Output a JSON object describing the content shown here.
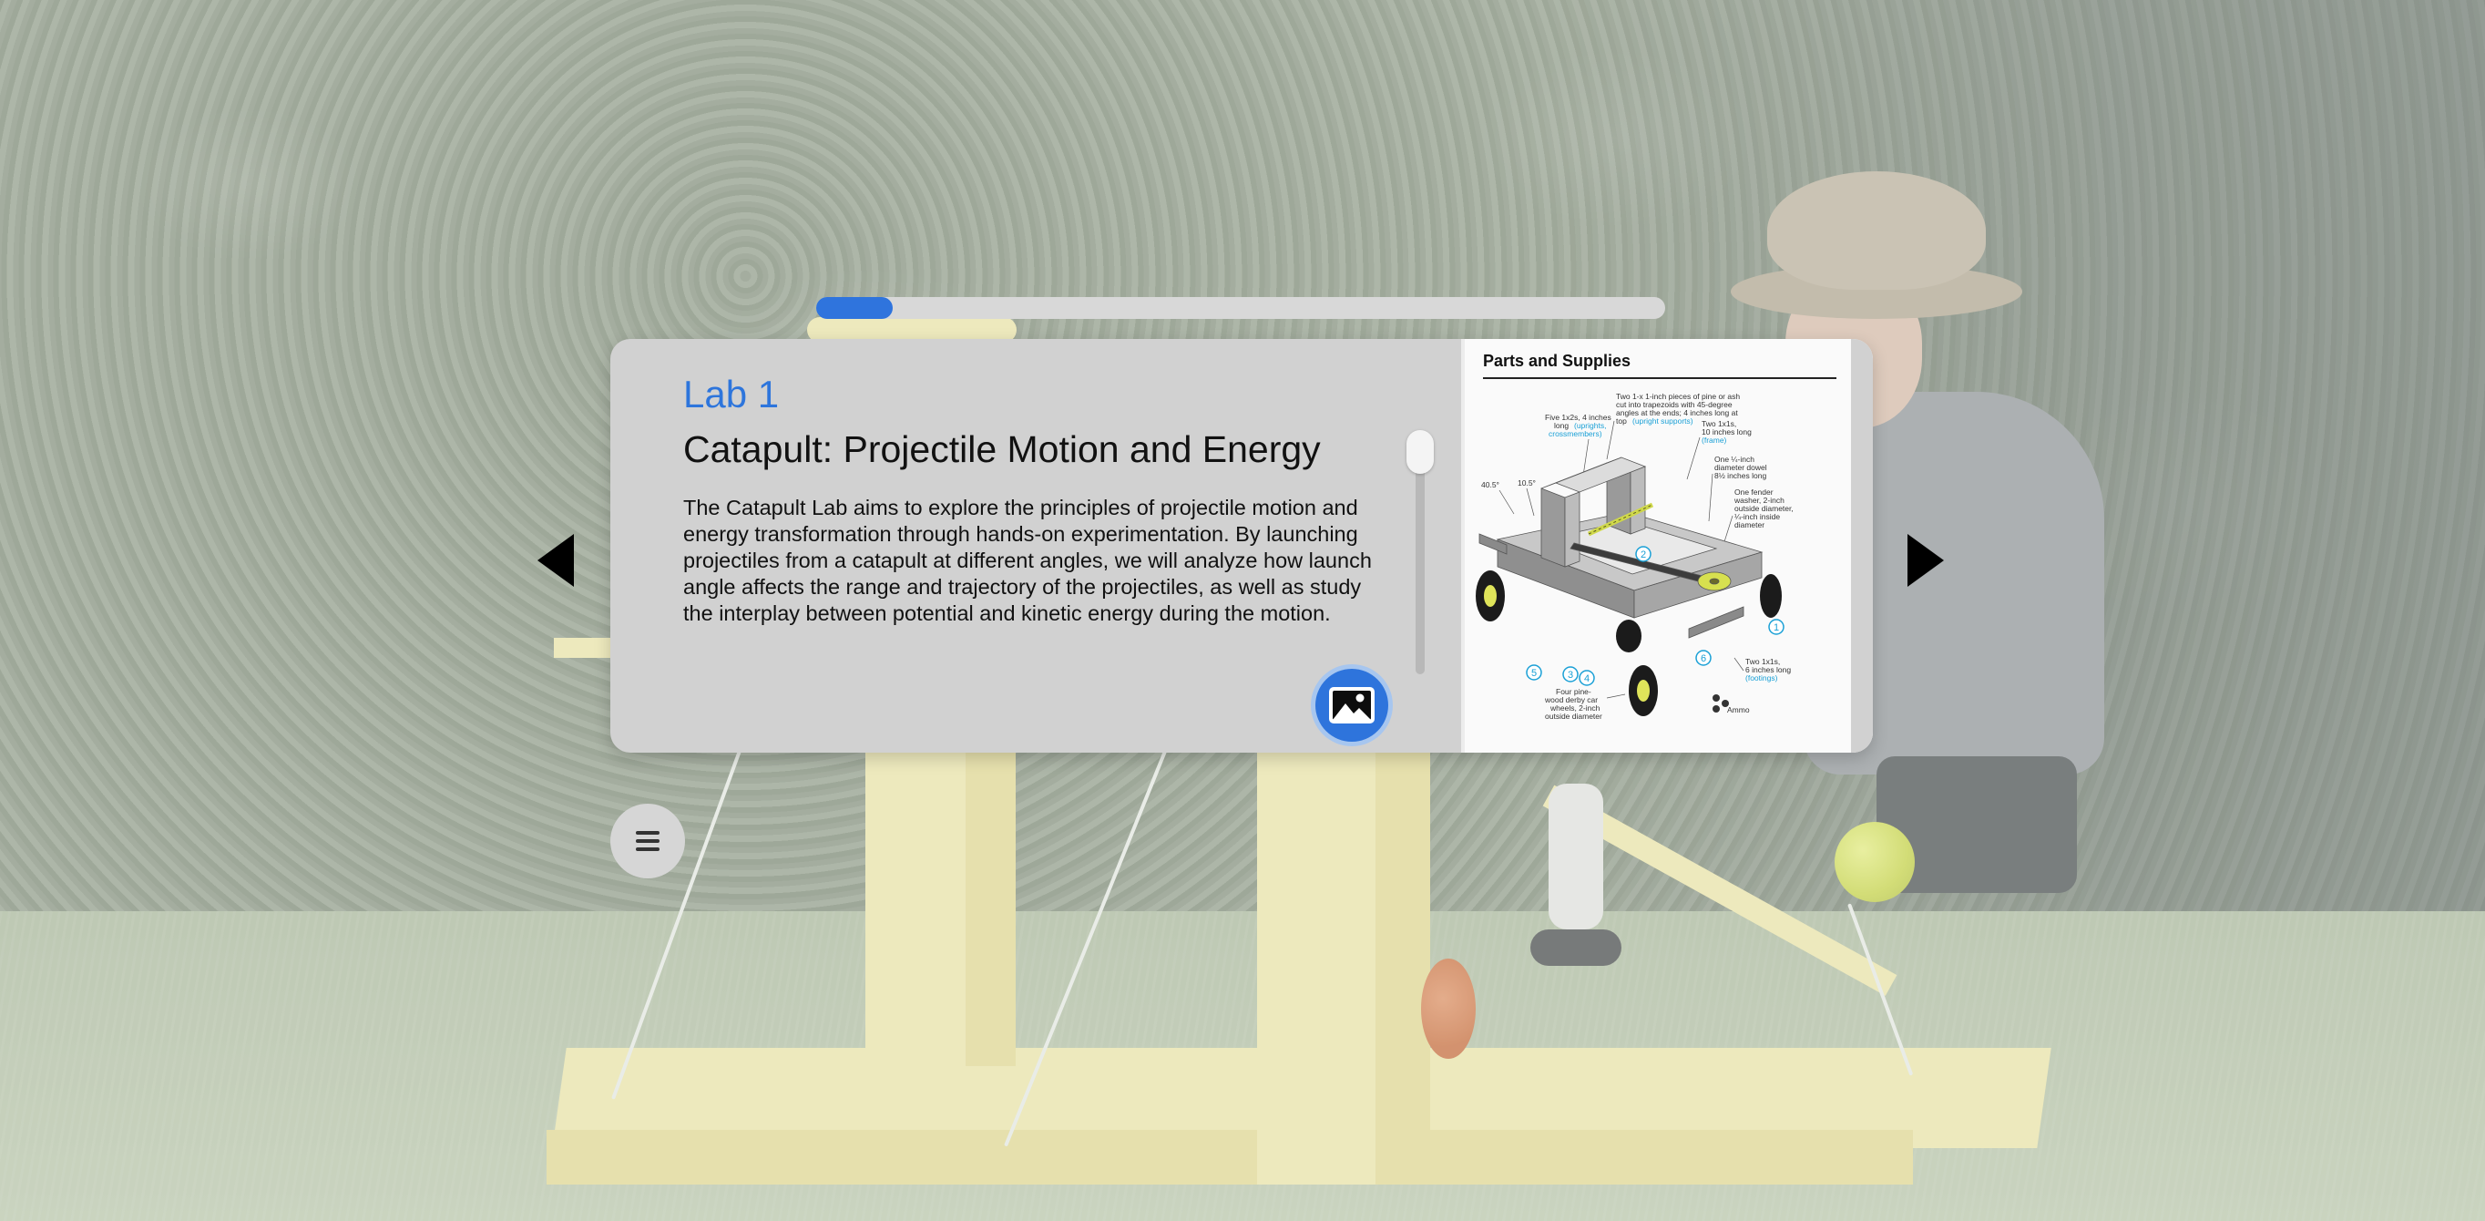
{
  "progress": {
    "value_percent": 9,
    "color": "#2f74dd"
  },
  "lab": {
    "number_label": "Lab 1",
    "title": "Catapult: Projectile Motion and Energy",
    "description": "The Catapult Lab aims to explore the principles of projectile motion and energy transformation through hands-on experimentation. By launching projectiles from a catapult at different angles, we will analyze how launch angle affects the range and trajectory of the projectiles, as well as study the interplay between potential and kinetic energy during the motion.",
    "accent_color": "#2d75dc"
  },
  "supplies": {
    "title": "Parts and Supplies",
    "callouts": {
      "pine_a": "Two 1-x 1-inch pieces of pine or ash",
      "pine_b": "cut into trapezoids with 45-degree",
      "pine_c": "angles at the ends; 4 inches long at",
      "pine_d": "top",
      "pine_blue": "(upright supports)",
      "five_a": "Five 1x2s, 4 inches",
      "five_b": "long",
      "five_blue_a": "(uprights,",
      "five_blue_b": "crossmembers)",
      "two_a": "Two 1x1s,",
      "two_b": "10 inches long",
      "two_blue": "(frame)",
      "dowel_a": "One ¼-inch",
      "dowel_b": "diameter dowel",
      "dowel_c": "8½ inches long",
      "washer_a": "One fender",
      "washer_b": "washer, 2-inch",
      "washer_c": "outside diameter,",
      "washer_d": "¼-inch inside",
      "washer_e": "diameter",
      "angle_a": "40.5°",
      "angle_b": "10.5°",
      "footing_a": "Two 1x1s,",
      "footing_b": "6 inches long",
      "footing_blue": "(footings)",
      "wheels_a": "Four pine-",
      "wheels_b": "wood derby car",
      "wheels_c": "wheels, 2-inch",
      "wheels_d": "outside diameter",
      "ammo": "Ammo"
    },
    "step_numbers": [
      "1",
      "2",
      "3",
      "4",
      "5",
      "6"
    ]
  },
  "icons": {
    "prev": "chevron-left-icon",
    "next": "chevron-right-icon",
    "image": "image-icon",
    "menu": "menu-icon"
  }
}
